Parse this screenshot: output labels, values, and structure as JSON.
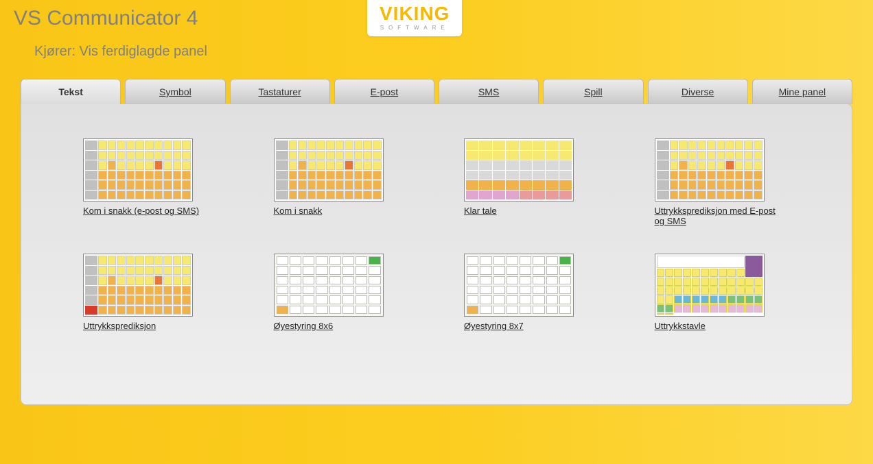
{
  "app": {
    "title": "VS Communicator 4",
    "subtitle": "Kjører: Vis ferdiglagde panel"
  },
  "logo": {
    "text": "VIKING",
    "subtext": "SOFTWARE"
  },
  "tabs": [
    {
      "id": "tekst",
      "label": "Tekst",
      "active": true
    },
    {
      "id": "symbol",
      "label": "Symbol",
      "active": false
    },
    {
      "id": "tastaturer",
      "label": "Tastaturer",
      "active": false
    },
    {
      "id": "epost",
      "label": "E-post",
      "active": false
    },
    {
      "id": "sms",
      "label": "SMS",
      "active": false
    },
    {
      "id": "spill",
      "label": "Spill",
      "active": false
    },
    {
      "id": "diverse",
      "label": "Diverse",
      "active": false
    },
    {
      "id": "mine-panel",
      "label": "Mine panel",
      "active": false
    }
  ],
  "panels": [
    {
      "id": "kom-i-snakk-epost-sms",
      "label": "Kom i snakk (e-post og SMS)",
      "thumb": "kbd"
    },
    {
      "id": "kom-i-snakk",
      "label": "Kom i snakk",
      "thumb": "kbd"
    },
    {
      "id": "klar-tale",
      "label": "Klar tale",
      "thumb": "cgrid"
    },
    {
      "id": "uttrykksprediksjon-epost-sms",
      "label": "Uttrykksprediksjon med E-post og SMS",
      "thumb": "kbd"
    },
    {
      "id": "uttrykksprediksjon",
      "label": "Uttrykksprediksjon",
      "thumb": "kbd-red"
    },
    {
      "id": "oyestyring-8x6",
      "label": "Øyestyring 8x6",
      "thumb": "grid6"
    },
    {
      "id": "oyestyring-8x7",
      "label": "Øyestyring 8x7",
      "thumb": "grid6"
    },
    {
      "id": "uttrykkstavle",
      "label": "Uttrykkstavle",
      "thumb": "tavle"
    }
  ]
}
